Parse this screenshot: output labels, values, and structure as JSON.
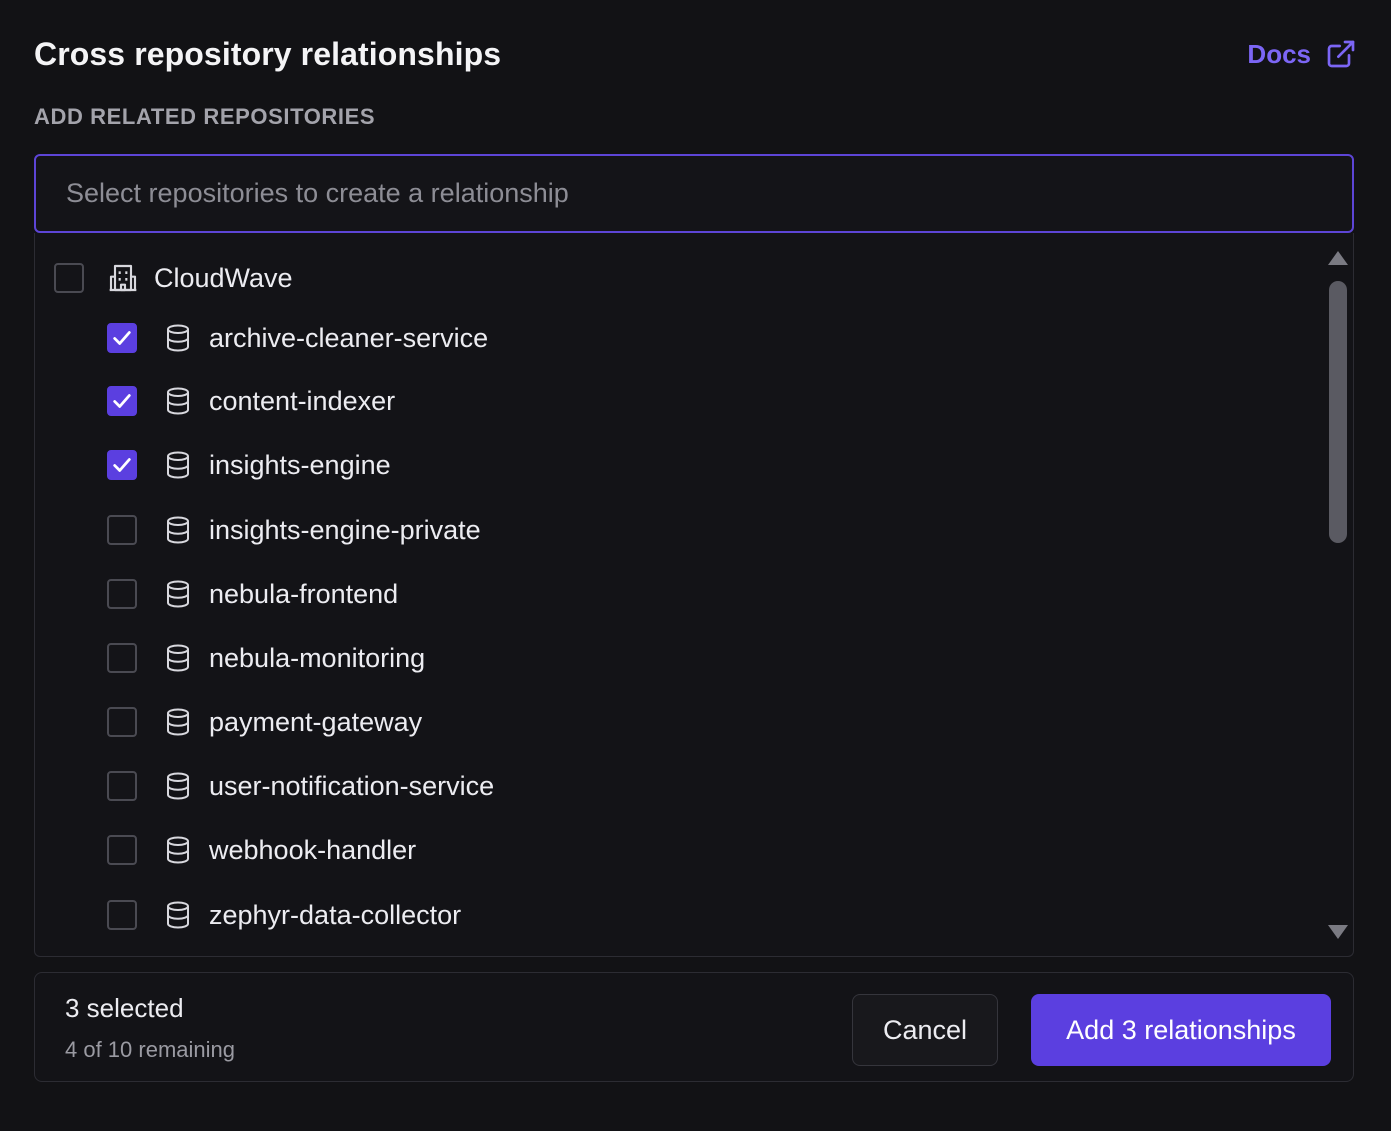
{
  "header": {
    "title": "Cross repository relationships",
    "docs_label": "Docs",
    "docs_icon": "external-link-icon"
  },
  "section": {
    "label": "ADD RELATED REPOSITORIES"
  },
  "search": {
    "placeholder": "Select repositories to create a relationship",
    "value": ""
  },
  "organization": {
    "name": "CloudWave",
    "icon": "building-icon",
    "checked": false
  },
  "repositories": [
    {
      "name": "archive-cleaner-service",
      "checked": true,
      "icon": "database-icon"
    },
    {
      "name": "content-indexer",
      "checked": true,
      "icon": "database-icon"
    },
    {
      "name": "insights-engine",
      "checked": true,
      "icon": "database-icon"
    },
    {
      "name": "insights-engine-private",
      "checked": false,
      "icon": "database-icon"
    },
    {
      "name": "nebula-frontend",
      "checked": false,
      "icon": "database-icon"
    },
    {
      "name": "nebula-monitoring",
      "checked": false,
      "icon": "database-icon"
    },
    {
      "name": "payment-gateway",
      "checked": false,
      "icon": "database-icon"
    },
    {
      "name": "user-notification-service",
      "checked": false,
      "icon": "database-icon"
    },
    {
      "name": "webhook-handler",
      "checked": false,
      "icon": "database-icon"
    },
    {
      "name": "zephyr-data-collector",
      "checked": false,
      "icon": "database-icon"
    }
  ],
  "footer": {
    "selected_text": "3 selected",
    "remaining_text": "4 of 10 remaining",
    "cancel_label": "Cancel",
    "add_label": "Add 3 relationships"
  },
  "colors": {
    "accent": "#5b3fe0",
    "link": "#7c66f5",
    "background": "#121215"
  }
}
